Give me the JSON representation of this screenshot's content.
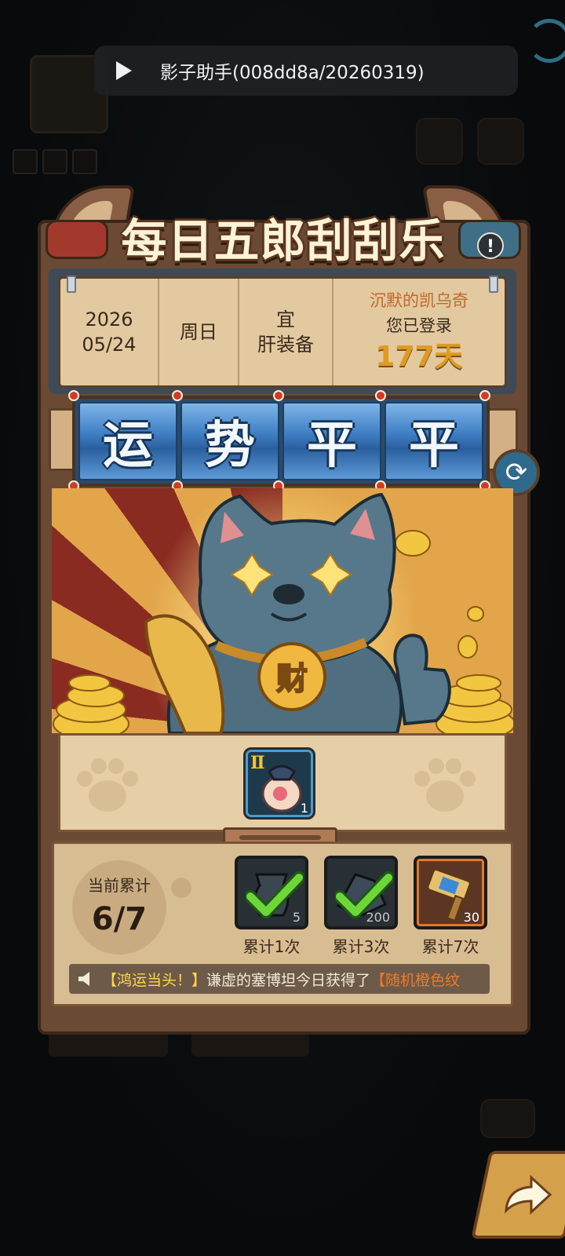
{
  "toast": {
    "text": "影子助手(008dd8a/20260319)"
  },
  "panel": {
    "title": "每日五郎刮刮乐",
    "info_icon": "!",
    "board": {
      "year": "2026",
      "date": "05/24",
      "weekday": "周日",
      "yi": "宜",
      "activity": "肝装备",
      "player_name": "沉默的凯乌奇",
      "login_label": "您已登录",
      "login_days": "177天"
    },
    "reels": [
      "运",
      "势",
      "平",
      "平"
    ],
    "reward": {
      "tier": "Ⅱ",
      "count": "1"
    },
    "accumulate": {
      "label": "当前累计",
      "value": "6/7"
    },
    "milestones": [
      {
        "count": "5",
        "caption": "累计1次",
        "claimed": true
      },
      {
        "count": "200",
        "caption": "累计3次",
        "claimed": true
      },
      {
        "count": "30",
        "caption": "累计7次",
        "claimed": false
      }
    ],
    "ticker": {
      "part1": "【鸿运当头！】",
      "part2": "谦虚的塞博坦今日获得了",
      "part3": "【随机橙色纹"
    }
  },
  "colors": {
    "accent_gold": "#e09a1e",
    "reel_blue": "#3f7fc4",
    "panel_brown": "#6b4a35"
  },
  "icons": [
    "play-icon",
    "info-icon",
    "refresh-icon",
    "speaker-icon",
    "check-icon",
    "paw-icon",
    "forward-arrow-icon"
  ]
}
